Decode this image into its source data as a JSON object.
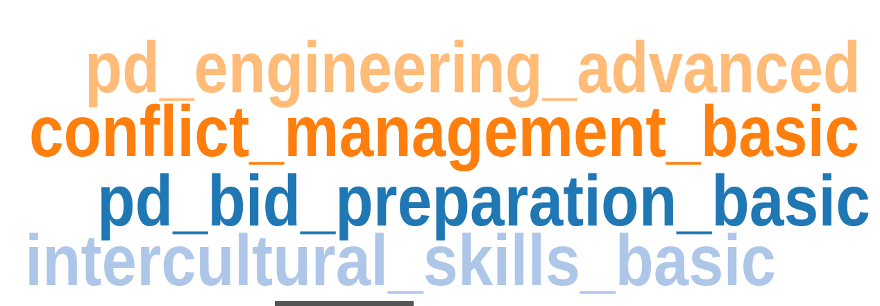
{
  "words": [
    {
      "text": "pd_engineering_advanced",
      "color": "#ffbb78"
    },
    {
      "text": "conflict_management_basic",
      "color": "#ff7f0e"
    },
    {
      "text": "pd_bid_preparation_basic",
      "color": "#1f77b4"
    },
    {
      "text": "intercultural_skills_basic",
      "color": "#aec7e8"
    }
  ]
}
